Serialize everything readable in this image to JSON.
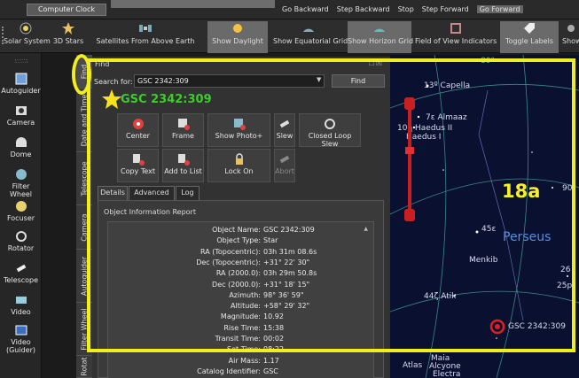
{
  "topbar": {
    "clock_label": "Computer Clock",
    "buttons": [
      "Go Backward",
      "Step Backward",
      "Stop",
      "Step Forward",
      "Go Forward"
    ]
  },
  "toolbar": {
    "items": [
      "Solar System",
      "3D Stars",
      "Satellites From Above Earth",
      "Show Daylight",
      "Show Equatorial Grid",
      "Show Horizon Grid",
      "Field of View Indicators",
      "Toggle Labels",
      "Show"
    ]
  },
  "left_panel": {
    "items": [
      "Autoguider",
      "Camera",
      "Dome",
      "Filter Wheel",
      "Focuser",
      "Rotator",
      "Telescope",
      "Video",
      "Video (Guider)"
    ]
  },
  "vertical_tabs": [
    "Find",
    "Date and Time",
    "Telescope",
    "Camera",
    "Autoguider",
    "Filter Wheel",
    "Rotat"
  ],
  "find": {
    "title": "Find",
    "window_controls": "☐☒",
    "search_label": "Search for:",
    "search_value": "GSC 2342:309",
    "find_button": "Find",
    "object_title": "GSC 2342:309",
    "actions": [
      "Center",
      "Frame",
      "Show Photo+",
      "Slew",
      "Closed Loop Slew",
      "Copy Text",
      "Add to List",
      "Lock On",
      "Abort"
    ],
    "subtabs": [
      "Details",
      "Advanced",
      "Log"
    ],
    "info_title": "Object Information Report",
    "rows": [
      {
        "k": "Object Name:",
        "v": "GSC 2342:309"
      },
      {
        "k": "Object Type:",
        "v": "Star"
      },
      {
        "k": "RA (Topocentric):",
        "v": "03h 31m 08.6s"
      },
      {
        "k": "Dec (Topocentric):",
        "v": "+31° 22' 30\""
      },
      {
        "k": "RA (2000.0):",
        "v": "03h 29m 50.8s"
      },
      {
        "k": "Dec (2000.0):",
        "v": "+31° 18' 15\""
      },
      {
        "k": "Azimuth:",
        "v": "98° 36' 59\""
      },
      {
        "k": "Altitude:",
        "v": "+58° 29' 32\""
      },
      {
        "k": "Magnitude:",
        "v": "10.92"
      },
      {
        "k": "Rise Time:",
        "v": "15:38"
      },
      {
        "k": "Transit Time:",
        "v": "00:02"
      },
      {
        "k": "Set Time:",
        "v": "08:22"
      },
      {
        "k": "Air Mass:",
        "v": "1.17"
      },
      {
        "k": "Catalog Identifier:",
        "v": "GSC"
      }
    ]
  },
  "sky": {
    "labels": {
      "deg80": "80°",
      "capella": "13º Capella",
      "almaaz": "7ε Almaaz",
      "haedus2": "10η Haedus II",
      "haedus1": "Haedus I",
      "perseus": "Perseus",
      "s45": "45ε",
      "menkib": "Menkib",
      "s26": "26",
      "s25p": "25p",
      "atik": "44ζ Atik",
      "gsc": "GSC 2342:309",
      "atlas": "Atlas",
      "alcyone": "Alcyone",
      "maia": "Maia",
      "electra": "Electra",
      "d90": "90°"
    },
    "annotation": "18a"
  },
  "colors": {
    "highlight": "#f2ee1c",
    "object_title": "#3ecb2e",
    "target": "#e02020"
  }
}
